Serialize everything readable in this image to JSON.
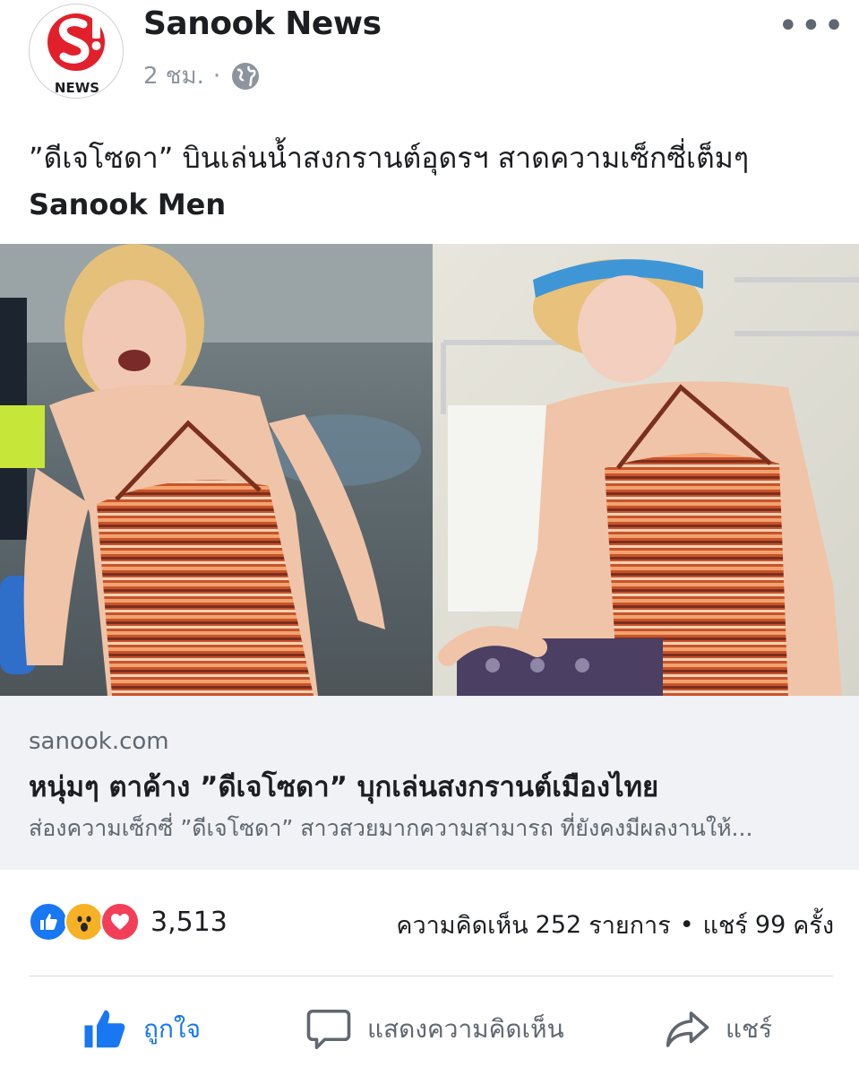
{
  "post": {
    "page_name": "Sanook News",
    "avatar_brand_text": "NEWS",
    "time": "2 ชม.",
    "dot": "·",
    "more": "•••",
    "caption_line1": "”ดีเจโซดา” บินเล่นน้ำสงกรานต์อุดรฯ สาดความเซ็กซี่เต็มๆ",
    "caption_line2": "Sanook Men"
  },
  "link_preview": {
    "info_icon": "i",
    "domain": "sanook.com",
    "title": "หนุ่มๆ ตาค้าง ”ดีเจโซดา” บุกเล่นสงกรานต์เมืองไทย",
    "description": "ส่องความเซ็กซี่ ”ดีเจโซดา” สาวสวยมากความสามารถ ที่ยังคงมีผลงานให้..."
  },
  "engagement": {
    "reaction_icons": [
      "like-icon",
      "wow-icon",
      "love-icon"
    ],
    "reaction_count": "3,513",
    "comments_label": "ความคิดเห็น",
    "comments_count": "252",
    "comments_unit": "รายการ",
    "separator": "•",
    "shares_label": "แชร์",
    "shares_count": "99",
    "shares_unit": "ครั้ง"
  },
  "actions": {
    "like": "ถูกใจ",
    "comment": "แสดงความคิดเห็น",
    "share": "แชร์"
  },
  "colors": {
    "facebook_blue": "#1877f2",
    "brand_red": "#e2202b",
    "link_box_bg": "#f0f2f5",
    "meta_gray": "#8d949e"
  }
}
